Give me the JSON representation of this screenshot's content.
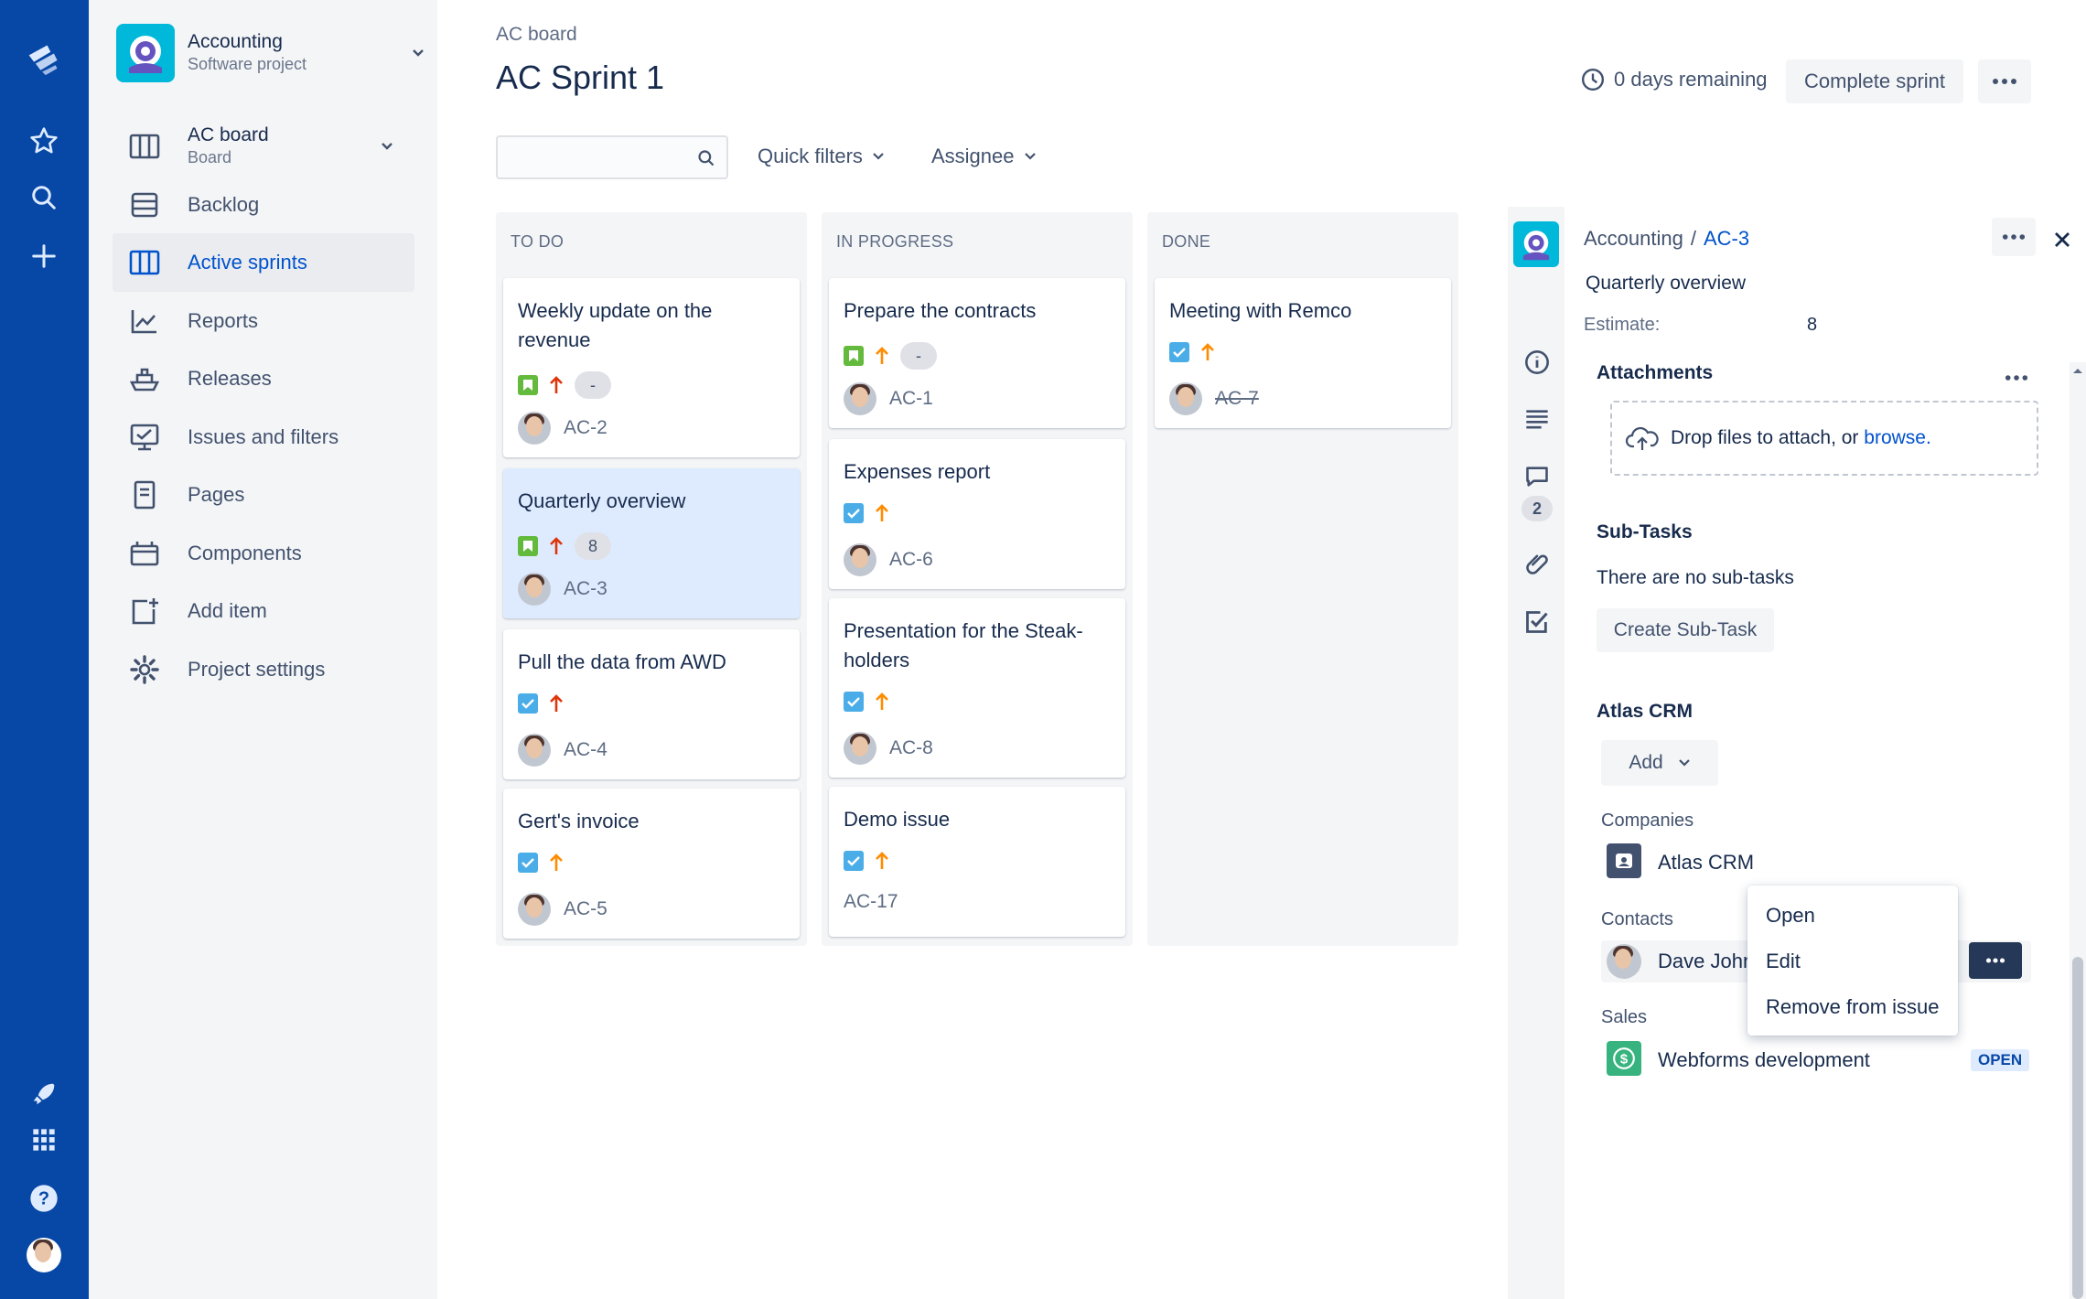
{
  "project": {
    "name": "Accounting",
    "type": "Software project"
  },
  "board_switch": {
    "name": "AC board",
    "type": "Board"
  },
  "nav": [
    {
      "label": "Backlog",
      "icon": "backlog-icon"
    },
    {
      "label": "Active sprints",
      "icon": "board-icon",
      "active": true
    },
    {
      "label": "Reports",
      "icon": "reports-icon"
    },
    {
      "label": "Releases",
      "icon": "ship-icon"
    },
    {
      "label": "Issues and filters",
      "icon": "issues-icon"
    },
    {
      "label": "Pages",
      "icon": "page-icon"
    },
    {
      "label": "Components",
      "icon": "component-icon"
    },
    {
      "label": "Add item",
      "icon": "add-item-icon"
    },
    {
      "label": "Project settings",
      "icon": "settings-icon"
    }
  ],
  "header": {
    "breadcrumb": "AC board",
    "title": "AC Sprint 1",
    "days_remaining": "0 days remaining",
    "complete_sprint": "Complete sprint"
  },
  "toolbar": {
    "search_value": "",
    "quick_filters": "Quick filters",
    "assignee": "Assignee"
  },
  "columns": [
    {
      "title": "TO DO",
      "cards": [
        {
          "title": "Weekly update on the revenue",
          "type": "story",
          "priority": "high",
          "estimate": "-",
          "key": "AC-2"
        },
        {
          "title": "Quarterly overview",
          "type": "story",
          "priority": "high",
          "estimate": "8",
          "key": "AC-3",
          "selected": true
        },
        {
          "title": "Pull the data from AWD",
          "type": "task",
          "priority": "high",
          "key": "AC-4"
        },
        {
          "title": "Gert's invoice",
          "type": "task",
          "priority": "medium",
          "key": "AC-5"
        }
      ]
    },
    {
      "title": "IN PROGRESS",
      "cards": [
        {
          "title": "Prepare the contracts",
          "type": "story",
          "priority": "medium",
          "estimate": "-",
          "key": "AC-1"
        },
        {
          "title": "Expenses report",
          "type": "task",
          "priority": "medium",
          "key": "AC-6"
        },
        {
          "title": "Presentation for the Steak-holders",
          "type": "task",
          "priority": "medium",
          "key": "AC-8"
        },
        {
          "title": "Demo issue",
          "type": "task",
          "priority": "medium",
          "key": "AC-17"
        }
      ]
    },
    {
      "title": "DONE",
      "cards": [
        {
          "title": "Meeting with Remco",
          "type": "task",
          "priority": "medium",
          "key": "AC-7",
          "done": true
        }
      ]
    }
  ],
  "detail": {
    "project": "Accounting",
    "separator": "/",
    "key": "AC-3",
    "summary": "Quarterly overview",
    "estimate_label": "Estimate:",
    "estimate_value": "8",
    "comment_count": "2",
    "attachments_title": "Attachments",
    "drop_text": "Drop files to attach, or ",
    "browse": "browse.",
    "subtasks_title": "Sub-Tasks",
    "no_subtasks": "There are no sub-tasks",
    "create_subtask": "Create Sub-Task",
    "crm_title": "Atlas CRM",
    "add": "Add",
    "companies_label": "Companies",
    "company": "Atlas CRM",
    "contacts_label": "Contacts",
    "contact": "Dave John",
    "sales_label": "Sales",
    "deal": "Webforms development",
    "deal_status": "OPEN"
  },
  "context_menu": [
    "Open",
    "Edit",
    "Remove from issue"
  ],
  "colors": {
    "nav_bg": "#0747a6",
    "link": "#0052cc",
    "story": "#63ba3c",
    "task": "#4bade8",
    "priority_high": "#de350b",
    "priority_medium": "#ff8b00"
  }
}
